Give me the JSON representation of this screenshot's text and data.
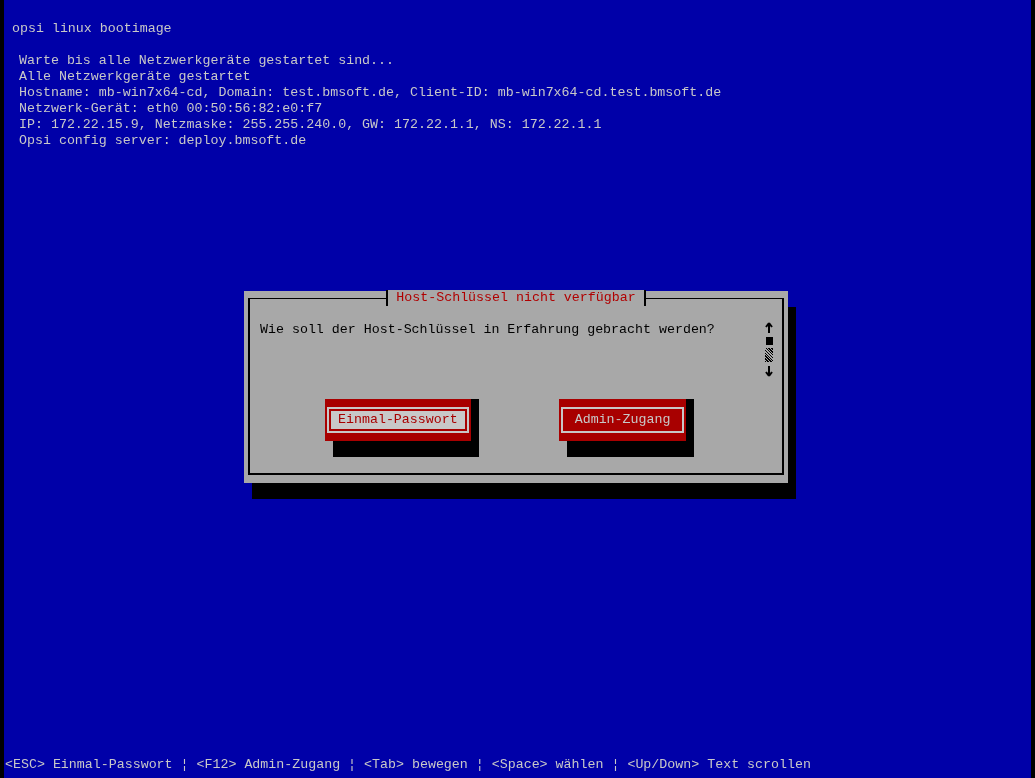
{
  "header": {
    "title": "opsi linux bootimage"
  },
  "log_lines": [
    "Warte bis alle Netzwerkgeräte gestartet sind...",
    "Alle Netzwerkgeräte gestartet",
    "Hostname: mb-win7x64-cd, Domain: test.bmsoft.de, Client-ID: mb-win7x64-cd.test.bmsoft.de",
    "Netzwerk-Gerät: eth0 00:50:56:82:e0:f7",
    "IP: 172.22.15.9, Netzmaske: 255.255.240.0, GW: 172.22.1.1, NS: 172.22.1.1",
    "Opsi config server: deploy.bmsoft.de"
  ],
  "dialog": {
    "title": "Host-Schlüssel nicht verfügbar",
    "message": "Wie soll der Host-Schlüssel in Erfahrung gebracht werden?",
    "buttons": [
      {
        "label": "Einmal-Passwort",
        "selected": true
      },
      {
        "label": "Admin-Zugang",
        "selected": false
      }
    ]
  },
  "status_bar": "<ESC> Einmal-Passwort ¦ <F12> Admin-Zugang ¦ <Tab> bewegen ¦ <Space> wählen ¦ <Up/Down> Text scrollen"
}
